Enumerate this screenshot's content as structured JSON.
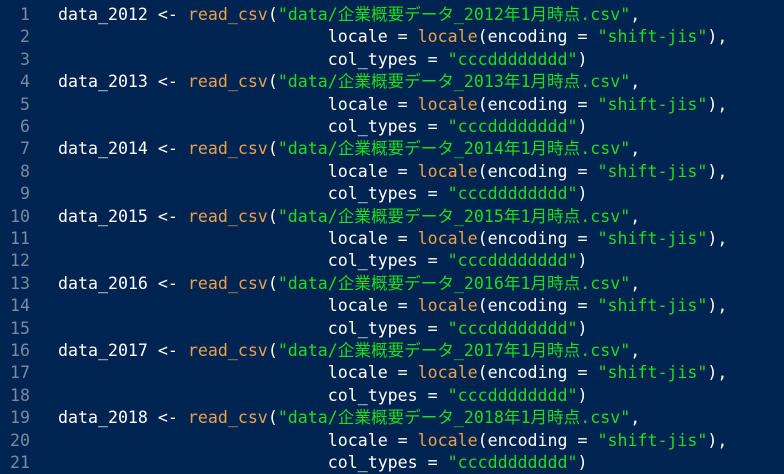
{
  "editor": {
    "colors": {
      "background": "#002451",
      "line_number": "#7a8aa0",
      "default": "#ffffff",
      "function": "#e8a24d",
      "string": "#1edc1e"
    },
    "lines": [
      {
        "n": "1",
        "tokens": [
          [
            "t",
            "data_2012 <- "
          ],
          [
            "f",
            "read_csv"
          ],
          [
            "t",
            "("
          ],
          [
            "s",
            "\"data/企業概要データ_2012年1月時点.csv\""
          ],
          [
            "t",
            ","
          ]
        ]
      },
      {
        "n": "2",
        "tokens": [
          [
            "t",
            "                           locale = "
          ],
          [
            "f",
            "locale"
          ],
          [
            "t",
            "(encoding = "
          ],
          [
            "s",
            "\"shift-jis\""
          ],
          [
            "t",
            "),"
          ]
        ]
      },
      {
        "n": "3",
        "tokens": [
          [
            "t",
            "                           col_types = "
          ],
          [
            "s",
            "\"cccdddddddd\""
          ],
          [
            "t",
            ")"
          ]
        ]
      },
      {
        "n": "4",
        "tokens": [
          [
            "t",
            "data_2013 <- "
          ],
          [
            "f",
            "read_csv"
          ],
          [
            "t",
            "("
          ],
          [
            "s",
            "\"data/企業概要データ_2013年1月時点.csv\""
          ],
          [
            "t",
            ","
          ]
        ]
      },
      {
        "n": "5",
        "tokens": [
          [
            "t",
            "                           locale = "
          ],
          [
            "f",
            "locale"
          ],
          [
            "t",
            "(encoding = "
          ],
          [
            "s",
            "\"shift-jis\""
          ],
          [
            "t",
            "),"
          ]
        ]
      },
      {
        "n": "6",
        "tokens": [
          [
            "t",
            "                           col_types = "
          ],
          [
            "s",
            "\"cccdddddddd\""
          ],
          [
            "t",
            ")"
          ]
        ]
      },
      {
        "n": "7",
        "tokens": [
          [
            "t",
            "data_2014 <- "
          ],
          [
            "f",
            "read_csv"
          ],
          [
            "t",
            "("
          ],
          [
            "s",
            "\"data/企業概要データ_2014年1月時点.csv\""
          ],
          [
            "t",
            ","
          ]
        ]
      },
      {
        "n": "8",
        "tokens": [
          [
            "t",
            "                           locale = "
          ],
          [
            "f",
            "locale"
          ],
          [
            "t",
            "(encoding = "
          ],
          [
            "s",
            "\"shift-jis\""
          ],
          [
            "t",
            "),"
          ]
        ]
      },
      {
        "n": "9",
        "tokens": [
          [
            "t",
            "                           col_types = "
          ],
          [
            "s",
            "\"cccdddddddd\""
          ],
          [
            "t",
            ")"
          ]
        ]
      },
      {
        "n": "10",
        "tokens": [
          [
            "t",
            "data_2015 <- "
          ],
          [
            "f",
            "read_csv"
          ],
          [
            "t",
            "("
          ],
          [
            "s",
            "\"data/企業概要データ_2015年1月時点.csv\""
          ],
          [
            "t",
            ","
          ]
        ]
      },
      {
        "n": "11",
        "tokens": [
          [
            "t",
            "                           locale = "
          ],
          [
            "f",
            "locale"
          ],
          [
            "t",
            "(encoding = "
          ],
          [
            "s",
            "\"shift-jis\""
          ],
          [
            "t",
            "),"
          ]
        ]
      },
      {
        "n": "12",
        "tokens": [
          [
            "t",
            "                           col_types = "
          ],
          [
            "s",
            "\"cccdddddddd\""
          ],
          [
            "t",
            ")"
          ]
        ]
      },
      {
        "n": "13",
        "tokens": [
          [
            "t",
            "data_2016 <- "
          ],
          [
            "f",
            "read_csv"
          ],
          [
            "t",
            "("
          ],
          [
            "s",
            "\"data/企業概要データ_2016年1月時点.csv\""
          ],
          [
            "t",
            ","
          ]
        ]
      },
      {
        "n": "14",
        "tokens": [
          [
            "t",
            "                           locale = "
          ],
          [
            "f",
            "locale"
          ],
          [
            "t",
            "(encoding = "
          ],
          [
            "s",
            "\"shift-jis\""
          ],
          [
            "t",
            "),"
          ]
        ]
      },
      {
        "n": "15",
        "tokens": [
          [
            "t",
            "                           col_types = "
          ],
          [
            "s",
            "\"cccdddddddd\""
          ],
          [
            "t",
            ")"
          ]
        ]
      },
      {
        "n": "16",
        "tokens": [
          [
            "t",
            "data_2017 <- "
          ],
          [
            "f",
            "read_csv"
          ],
          [
            "t",
            "("
          ],
          [
            "s",
            "\"data/企業概要データ_2017年1月時点.csv\""
          ],
          [
            "t",
            ","
          ]
        ]
      },
      {
        "n": "17",
        "tokens": [
          [
            "t",
            "                           locale = "
          ],
          [
            "f",
            "locale"
          ],
          [
            "t",
            "(encoding = "
          ],
          [
            "s",
            "\"shift-jis\""
          ],
          [
            "t",
            "),"
          ]
        ]
      },
      {
        "n": "18",
        "tokens": [
          [
            "t",
            "                           col_types = "
          ],
          [
            "s",
            "\"cccdddddddd\""
          ],
          [
            "t",
            ")"
          ]
        ]
      },
      {
        "n": "19",
        "tokens": [
          [
            "t",
            "data_2018 <- "
          ],
          [
            "f",
            "read_csv"
          ],
          [
            "t",
            "("
          ],
          [
            "s",
            "\"data/企業概要データ_2018年1月時点.csv\""
          ],
          [
            "t",
            ","
          ]
        ]
      },
      {
        "n": "20",
        "tokens": [
          [
            "t",
            "                           locale = "
          ],
          [
            "f",
            "locale"
          ],
          [
            "t",
            "(encoding = "
          ],
          [
            "s",
            "\"shift-jis\""
          ],
          [
            "t",
            "),"
          ]
        ]
      },
      {
        "n": "21",
        "tokens": [
          [
            "t",
            "                           col_types = "
          ],
          [
            "s",
            "\"cccdddddddd\""
          ],
          [
            "t",
            ")"
          ]
        ]
      }
    ]
  }
}
